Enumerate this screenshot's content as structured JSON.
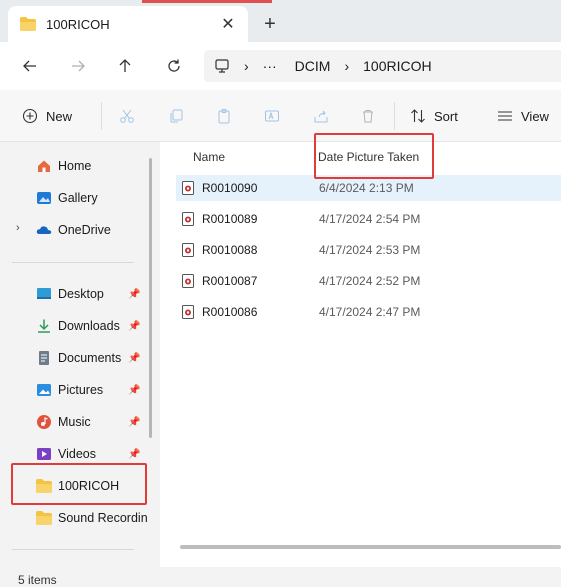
{
  "window": {
    "tab_title": "100RICOH",
    "tab_close": "✕",
    "new_tab": "+"
  },
  "address": {
    "ellipsis": "···",
    "crumbs": [
      "DCIM",
      "100RICOH"
    ]
  },
  "toolbar": {
    "new_label": "New",
    "sort_label": "Sort",
    "view_label": "View"
  },
  "sidebar": {
    "items": [
      {
        "label": "Home"
      },
      {
        "label": "Gallery"
      },
      {
        "label": "OneDrive"
      },
      {
        "label": "Desktop"
      },
      {
        "label": "Downloads"
      },
      {
        "label": "Documents"
      },
      {
        "label": "Pictures"
      },
      {
        "label": "Music"
      },
      {
        "label": "Videos"
      },
      {
        "label": "100RICOH"
      },
      {
        "label": "Sound Recordin"
      }
    ]
  },
  "files": {
    "columns": {
      "name": "Name",
      "date": "Date Picture Taken"
    },
    "rows": [
      {
        "name": "R0010090",
        "date": "6/4/2024 2:13 PM"
      },
      {
        "name": "R0010089",
        "date": "4/17/2024 2:54 PM"
      },
      {
        "name": "R0010088",
        "date": "4/17/2024 2:53 PM"
      },
      {
        "name": "R0010087",
        "date": "4/17/2024 2:52 PM"
      },
      {
        "name": "R0010086",
        "date": "4/17/2024 2:47 PM"
      }
    ]
  },
  "status": {
    "item_count": "5 items"
  },
  "colors": {
    "highlight": "#e23b3b",
    "selection": "#e5f1fb",
    "folder": "#f5c342"
  }
}
